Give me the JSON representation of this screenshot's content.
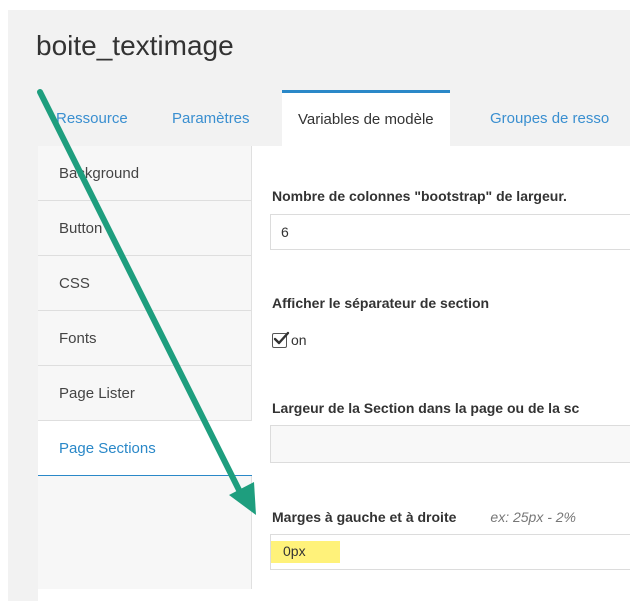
{
  "resource": {
    "title": "boite_textimage"
  },
  "tabs": [
    {
      "label": "Ressource",
      "active": false
    },
    {
      "label": "Paramètres",
      "active": false
    },
    {
      "label": "Variables de modèle",
      "active": true
    },
    {
      "label": "Groupes de resso",
      "active": false
    }
  ],
  "sidebar": {
    "items": [
      {
        "label": "Background"
      },
      {
        "label": "Button"
      },
      {
        "label": "CSS"
      },
      {
        "label": "Fonts"
      },
      {
        "label": "Page Lister"
      },
      {
        "label": "Page Sections"
      }
    ],
    "active_item": "Page Sections"
  },
  "fields": {
    "columns": {
      "label": "Nombre de colonnes \"bootstrap\" de largeur.",
      "value": "6"
    },
    "separator": {
      "label": "Afficher le séparateur de section",
      "checkbox_label": "on",
      "checked": true
    },
    "width": {
      "label": "Largeur de la Section dans la page ou de la sc",
      "value": ""
    },
    "margins": {
      "label": "Marges à gauche et à droite",
      "hint": "ex: 25px - 2%",
      "value": "0px"
    }
  },
  "colors": {
    "accent": "#2a88c8",
    "tab_link": "#3a8fd0",
    "arrow": "#1e9e7e",
    "highlight": "#fff27a"
  },
  "icons": [
    "checkbox-checked-icon",
    "annotation-arrow"
  ]
}
